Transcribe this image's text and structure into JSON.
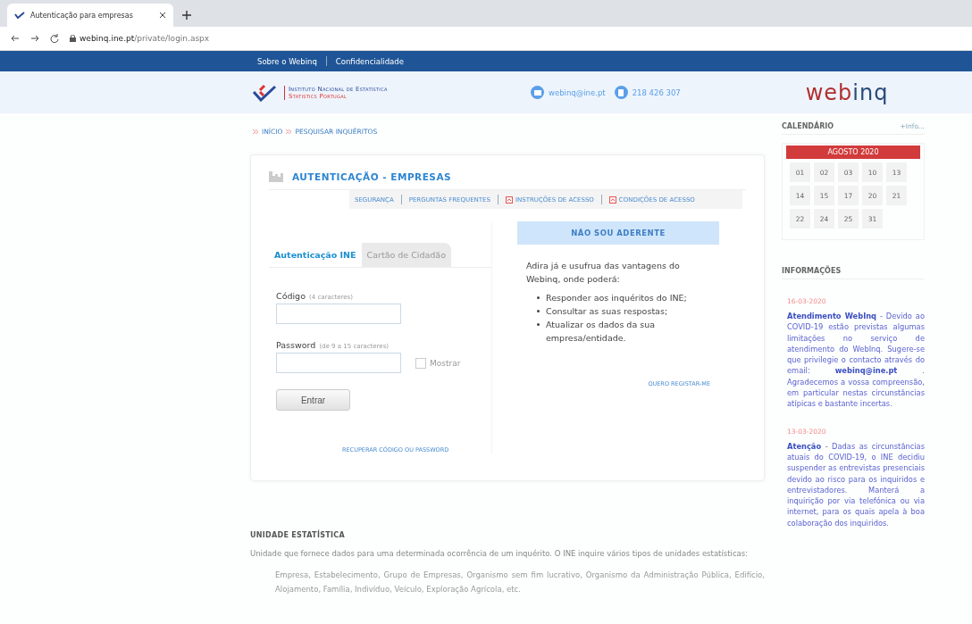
{
  "browser": {
    "tab_title": "Autenticação para empresas",
    "url_host": "webinq.ine.pt",
    "url_path": "/private/login.aspx"
  },
  "top_nav": [
    "Sobre o Webinq",
    "Confidencialidade"
  ],
  "header": {
    "institute_line1": "Instituto Nacional de Estatística",
    "institute_line2": "Statistics Portugal",
    "email": "webinq@ine.pt",
    "phone": "218 426 307",
    "logo_left": "web",
    "logo_right": "inq"
  },
  "breadcrumb": [
    "INÍCIO",
    "PESQUISAR INQUÉRITOS"
  ],
  "card": {
    "title": "AUTENTICAÇÃO - EMPRESAS",
    "links": [
      {
        "label": "SEGURANÇA",
        "kind": "plain"
      },
      {
        "label": "PERGUNTAS FREQUENTES",
        "kind": "plain"
      },
      {
        "label": "INSTRUÇÕES DE ACESSO",
        "kind": "pdf"
      },
      {
        "label": "CONDIÇÕES DE ACESSO",
        "kind": "pdf"
      }
    ],
    "tabs": [
      {
        "label": "Autenticação INE",
        "selected": true
      },
      {
        "label": "Cartão de Cidadão",
        "selected": false
      }
    ],
    "code_label": "Código",
    "code_hint": "(4 caracteres)",
    "password_label": "Password",
    "password_hint": "(de 9 a 15 caracteres)",
    "show_label": "Mostrar",
    "show_checked": false,
    "submit": "Entrar",
    "recover": "RECUPERAR CÓDIGO OU PASSWORD",
    "panel": {
      "title": "NÃO SOU ADERENTE",
      "intro": "Adira já e usufrua das vantagens do Webinq, onde poderá:",
      "bullets": [
        "Responder aos inquéritos do INE;",
        "Consultar as suas respostas;",
        "Atualizar os dados da sua empresa/entidade."
      ],
      "register": "QUERO REGISTAR-ME"
    }
  },
  "section": {
    "title": "UNIDADE ESTATÍSTICA",
    "text": "Unidade que fornece dados para uma determinada ocorrência de um inquérito. O INE inquire vários tipos de unidades estatísticas:",
    "examples": "Empresa, Estabelecimento, Grupo de Empresas, Organismo sem fim lucrativo, Organismo da Administração Pública, Edifício, Alojamento, Família, Indivíduo, Veículo, Exploração Agrícola, etc."
  },
  "calendar": {
    "title": "CALENDÁRIO",
    "more": "+Info...",
    "month": "AGOSTO 2020",
    "days": [
      "01",
      "02",
      "03",
      "10",
      "13",
      "14",
      "15",
      "17",
      "20",
      "21",
      "22",
      "24",
      "25",
      "31"
    ]
  },
  "news": {
    "title": "INFORMAÇÕES",
    "items": [
      {
        "date": "16-03-2020",
        "text": "**Atendimento WebInq** - Devido ao COVID-19 estão previstas algumas limitações no serviço de atendimento do WebInq. Sugere-se que privilegie o contacto através do email: **webinq@ine.pt** . Agradecemos a vossa compreensão, em particular nestas circunstâncias atípicas e bastante incertas."
      },
      {
        "date": "13-03-2020",
        "text": "**Atenção** - Dadas as circunstâncias atuais do COVID-19, o INE decidiu suspender as entrevistas presenciais devido ao risco para os inquiridos e entrevistadores. Manterá a inquirição por via telefónica ou via internet, para os quais apela à boa colaboração dos inquiridos."
      }
    ]
  }
}
